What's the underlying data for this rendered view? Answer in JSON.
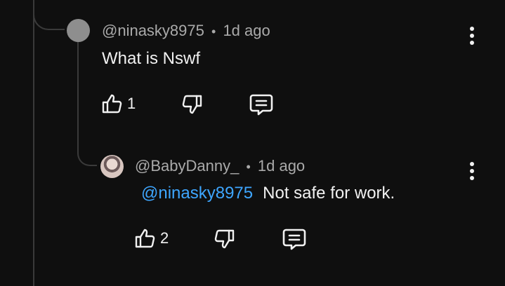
{
  "comment": {
    "handle": "@ninasky8975",
    "separator": "•",
    "time": "1d ago",
    "text": "What is Nswf",
    "likes": "1",
    "icons": [
      "like-icon",
      "dislike-icon",
      "reply-icon",
      "more-icon"
    ]
  },
  "reply": {
    "handle": "@BabyDanny_",
    "separator": "•",
    "time": "1d ago",
    "mention": "@ninasky8975",
    "text": "Not safe for work.",
    "likes": "2",
    "icons": [
      "like-icon",
      "dislike-icon",
      "reply-icon",
      "more-icon"
    ]
  },
  "colors": {
    "background": "#0f0f0f",
    "text": "#f1f1f1",
    "meta": "#aaaaaa",
    "mention": "#3ea6ff",
    "thread_line": "#3a3a3a"
  }
}
